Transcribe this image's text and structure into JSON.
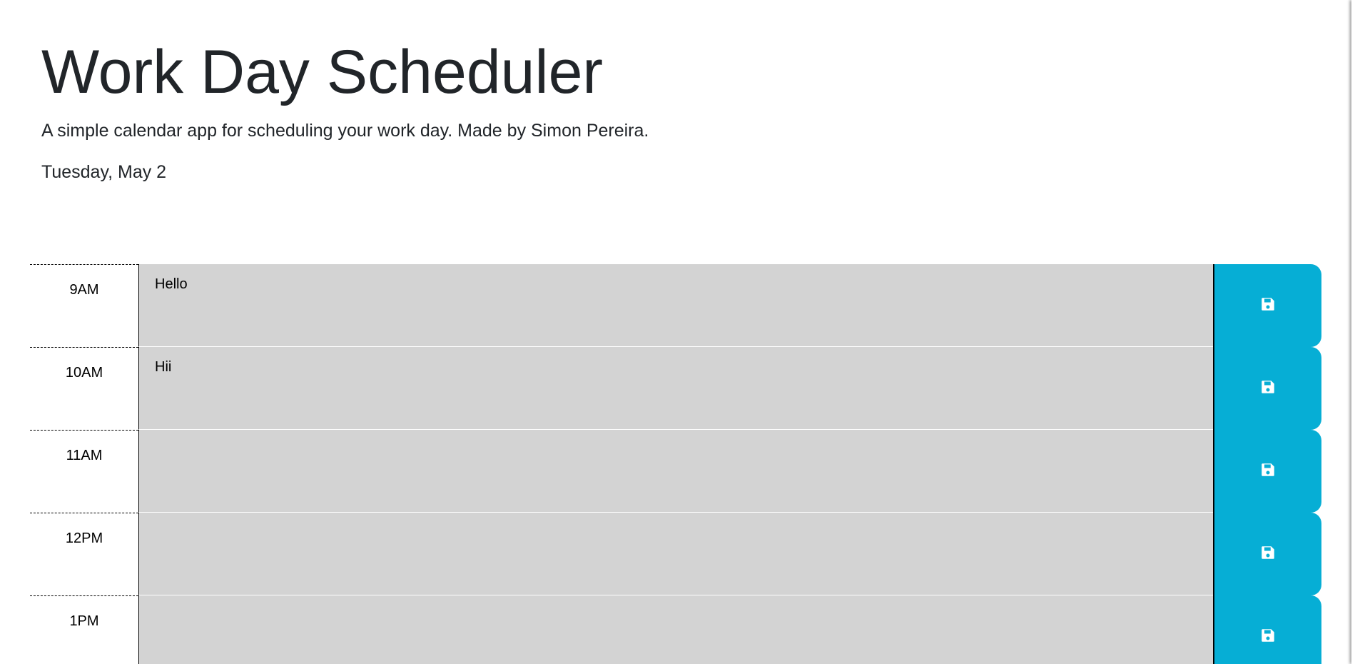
{
  "header": {
    "title": "Work Day Scheduler",
    "lead": "A simple calendar app for scheduling your work day. Made by Simon Pereira.",
    "current_day": "Tuesday, May 2"
  },
  "colors": {
    "past": "#d3d3d3",
    "save_button": "#06aed5",
    "save_icon": "#ffffff"
  },
  "schedule": {
    "save_icon": "floppy-disk-icon",
    "rows": [
      {
        "hour": "9AM",
        "text": "Hello"
      },
      {
        "hour": "10AM",
        "text": "Hii"
      },
      {
        "hour": "11AM",
        "text": ""
      },
      {
        "hour": "12PM",
        "text": ""
      },
      {
        "hour": "1PM",
        "text": ""
      }
    ]
  }
}
